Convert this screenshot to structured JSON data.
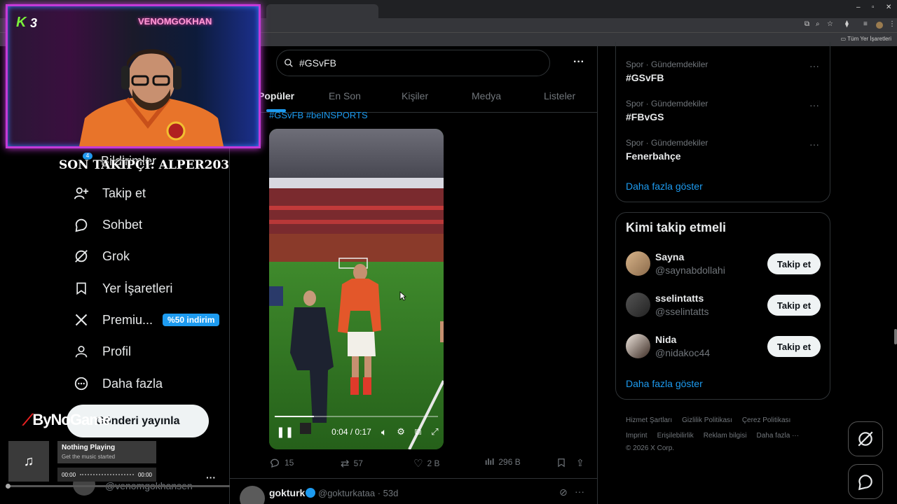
{
  "browser": {
    "bookmarks_label": "Tüm Yer İşaretleri"
  },
  "overlay": {
    "streamer_name": "VENOMGOKHAN",
    "k_logo": "K",
    "k_number": "3",
    "last_follower": "SON TAKİPÇİ: ALPER203",
    "sponsor": "ByNoGame"
  },
  "sidebar": {
    "notifications_label": "Bildirimler",
    "notifications_count": "4",
    "items": [
      {
        "label": "Takip et",
        "icon": "add-user-icon"
      },
      {
        "label": "Sohbet",
        "icon": "chat-icon"
      },
      {
        "label": "Grok",
        "icon": "grok-icon"
      },
      {
        "label": "Yer İşaretleri",
        "icon": "bookmark-icon"
      },
      {
        "label": "Premiu...",
        "icon": "x-logo-icon",
        "badge": "%50 indirim"
      },
      {
        "label": "Profil",
        "icon": "profile-icon"
      },
      {
        "label": "Daha fazla",
        "icon": "more-icon"
      }
    ],
    "post_button": "Gönderi yayınla",
    "profile_handle": "@venomgokhansen",
    "profile_more": "···"
  },
  "music": {
    "title": "Nothing Playing",
    "subtitle": "Get the music started",
    "time_start": "00:00",
    "time_end": "00:00"
  },
  "search": {
    "query": "#GSvFB",
    "more": "···"
  },
  "tabs": [
    {
      "label": "Popüler",
      "active": true
    },
    {
      "label": "En Son"
    },
    {
      "label": "Kişiler"
    },
    {
      "label": "Medya"
    },
    {
      "label": "Listeler"
    }
  ],
  "tweet": {
    "hashtags": "#GSvFB #beINSPORTS",
    "video_time": "0:04 / 0:17",
    "video_progress": 0.24,
    "replies": "15",
    "reposts": "57",
    "likes": "2 B",
    "views": "296 B"
  },
  "next_tweet": {
    "name": "gokturk",
    "handle": "@gokturkataa · 53d",
    "more": "···"
  },
  "trends": [
    {
      "category": "Spor · Gündemdekiler",
      "name": "#GSvFB"
    },
    {
      "category": "Spor · Gündemdekiler",
      "name": "#FBvGS"
    },
    {
      "category": "Spor · Gündemdekiler",
      "name": "Fenerbahçe"
    }
  ],
  "trends_show_more": "Daha fazla göster",
  "who_to_follow": {
    "title": "Kimi takip etmeli",
    "users": [
      {
        "name": "Sayna",
        "handle": "@saynabdollahi",
        "button": "Takip et"
      },
      {
        "name": "sselintatts",
        "handle": "@sselintatts",
        "button": "Takip et"
      },
      {
        "name": "Nida",
        "handle": "@nidakoc44",
        "button": "Takip et"
      }
    ],
    "show_more": "Daha fazla göster"
  },
  "footer": {
    "links": [
      "Hizmet Şartları",
      "Gizlilik Politikası",
      "Çerez Politikası",
      "Imprint",
      "Erişilebilirlik",
      "Reklam bilgisi",
      "Daha fazla ···"
    ],
    "copyright": "© 2026 X Corp."
  },
  "colors": {
    "accent": "#1d9bf0",
    "background": "#000000",
    "overlay_border": "#c53ad8"
  }
}
